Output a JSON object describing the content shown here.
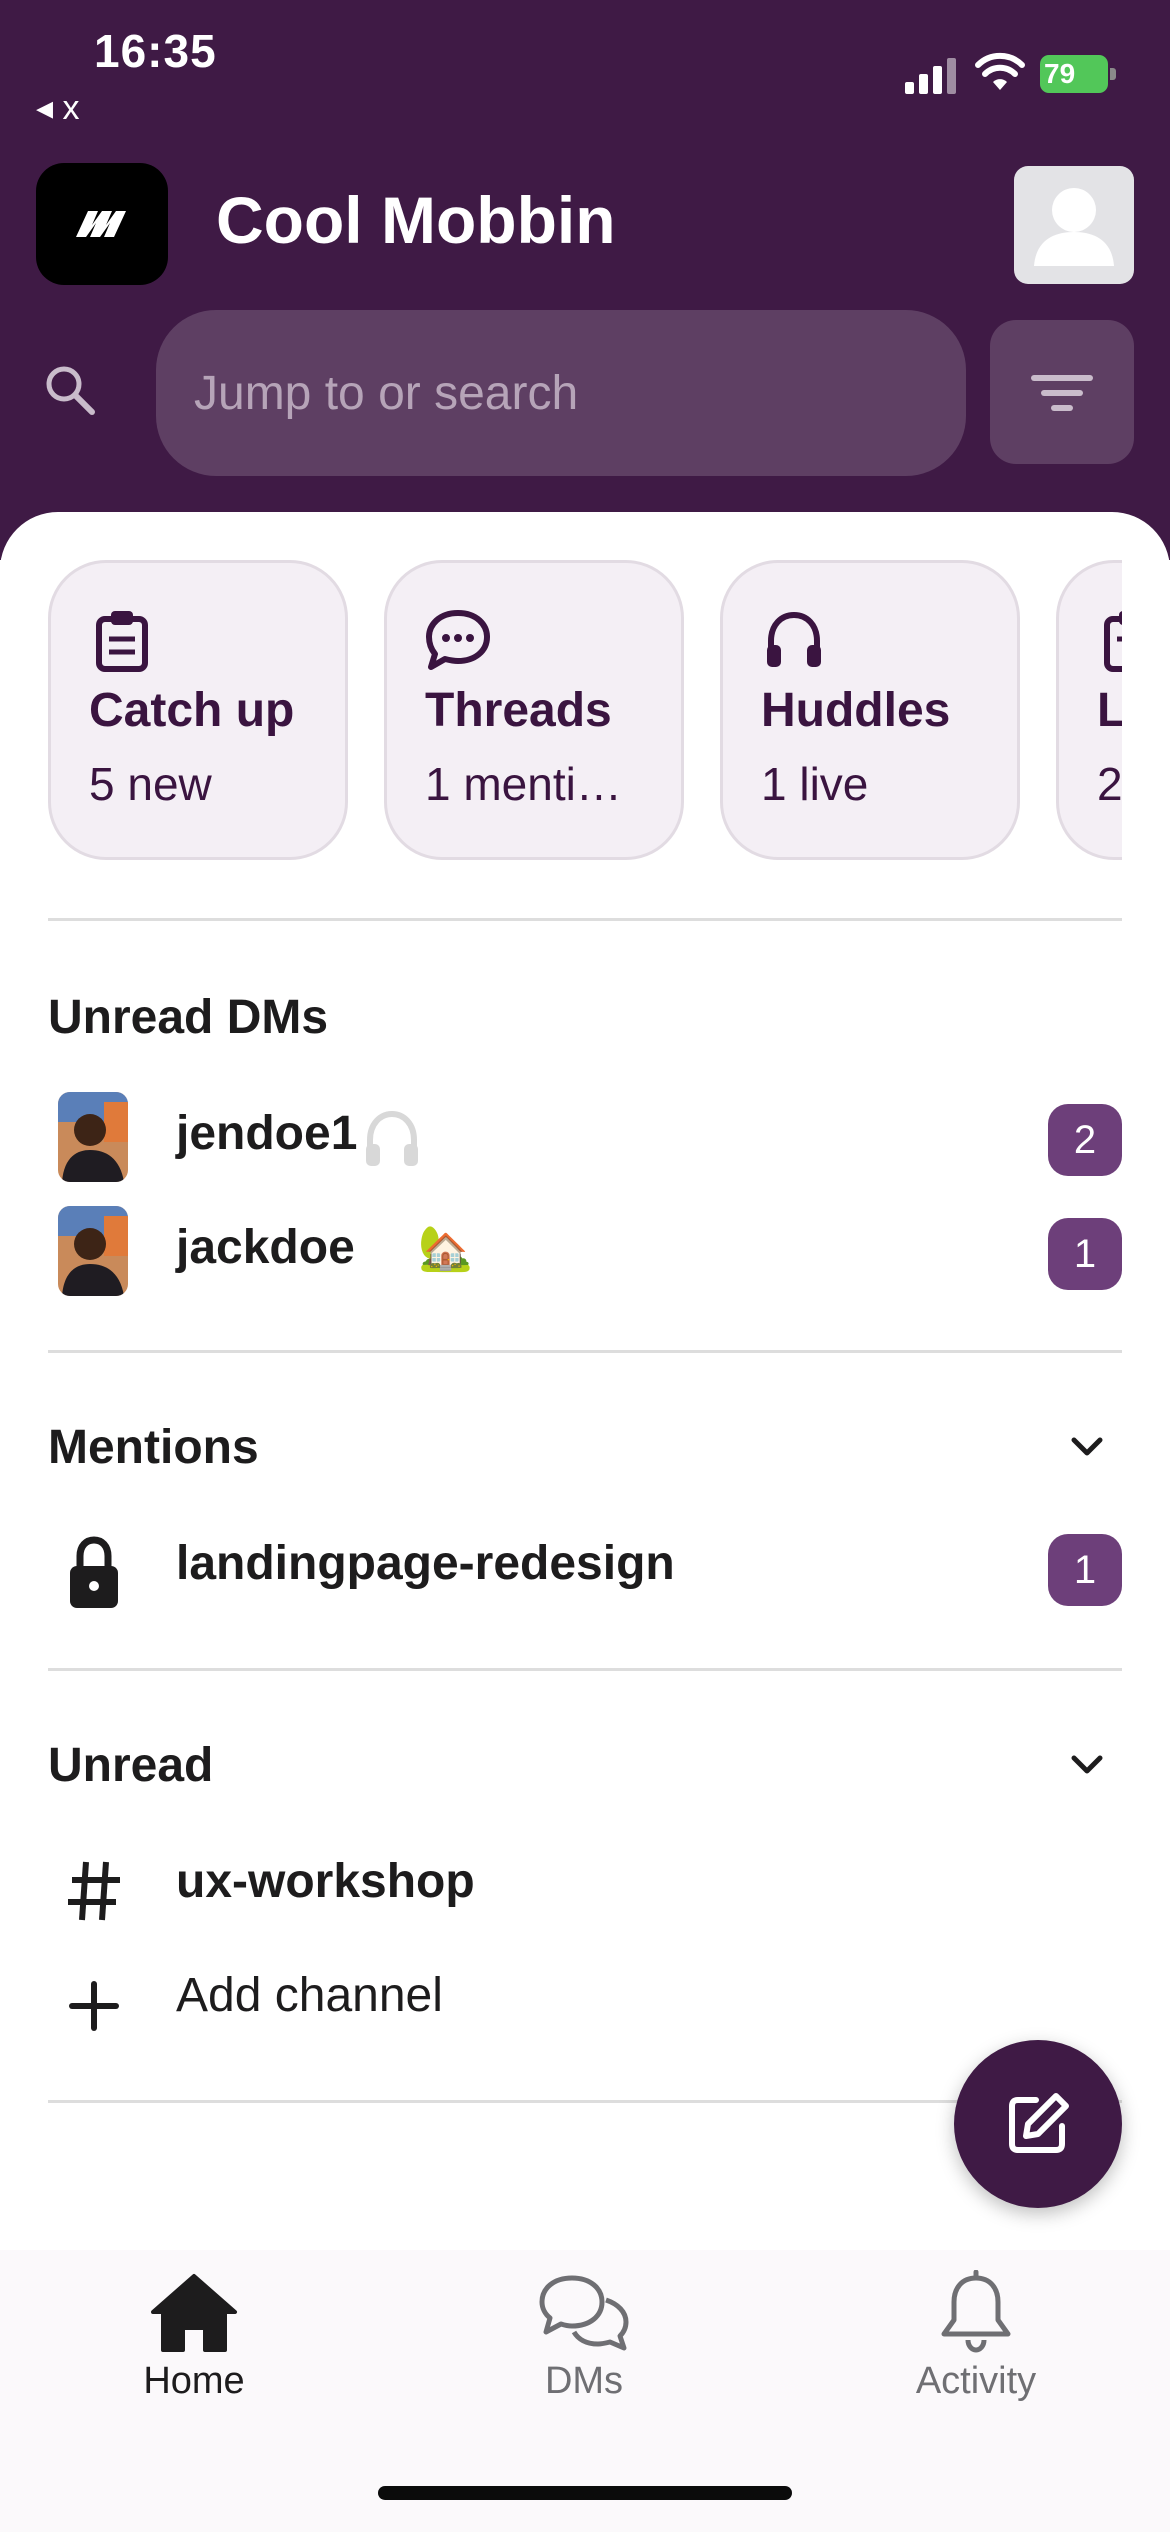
{
  "status_bar": {
    "time": "16:35",
    "back_label": "◂ x",
    "battery": "79"
  },
  "workspace": {
    "name": "Cool Mobbin",
    "logo_icon": "workspace-logo-icon",
    "avatar_icon": "profile-avatar-icon"
  },
  "search": {
    "placeholder": "Jump to or search",
    "value": ""
  },
  "quick_cards": [
    {
      "title": "Catch up",
      "subtitle": "5 new",
      "icon": "clipboard-icon"
    },
    {
      "title": "Threads",
      "subtitle": "1 menti…",
      "icon": "speech-bubble-icon"
    },
    {
      "title": "Huddles",
      "subtitle": "1 live",
      "icon": "headphones-icon"
    },
    {
      "title": "L",
      "subtitle": "2",
      "icon": "clipboard-icon"
    }
  ],
  "unread_dms": {
    "title": "Unread DMs",
    "items": [
      {
        "name": "jendoe1",
        "badge": "2",
        "status_icon": "headphones-icon"
      },
      {
        "name": "jackdoe",
        "badge": "1",
        "status_emoji": "🏡"
      }
    ]
  },
  "mentions": {
    "title": "Mentions",
    "items": [
      {
        "name": "landingpage-redesign",
        "badge": "1",
        "icon": "lock-icon"
      }
    ]
  },
  "unread": {
    "title": "Unread",
    "items": [
      {
        "name": "ux-workshop",
        "icon": "hash-icon"
      }
    ],
    "add_channel": "Add channel"
  },
  "tabs": [
    {
      "label": "Home",
      "icon": "home-icon",
      "active": true
    },
    {
      "label": "DMs",
      "icon": "dms-icon",
      "active": false
    },
    {
      "label": "Activity",
      "icon": "bell-icon",
      "active": false
    }
  ],
  "colors": {
    "header": "#3f1a45",
    "badge": "#6d3f7a",
    "card_bg": "#f4eff5",
    "accent_text": "#3a1440"
  }
}
